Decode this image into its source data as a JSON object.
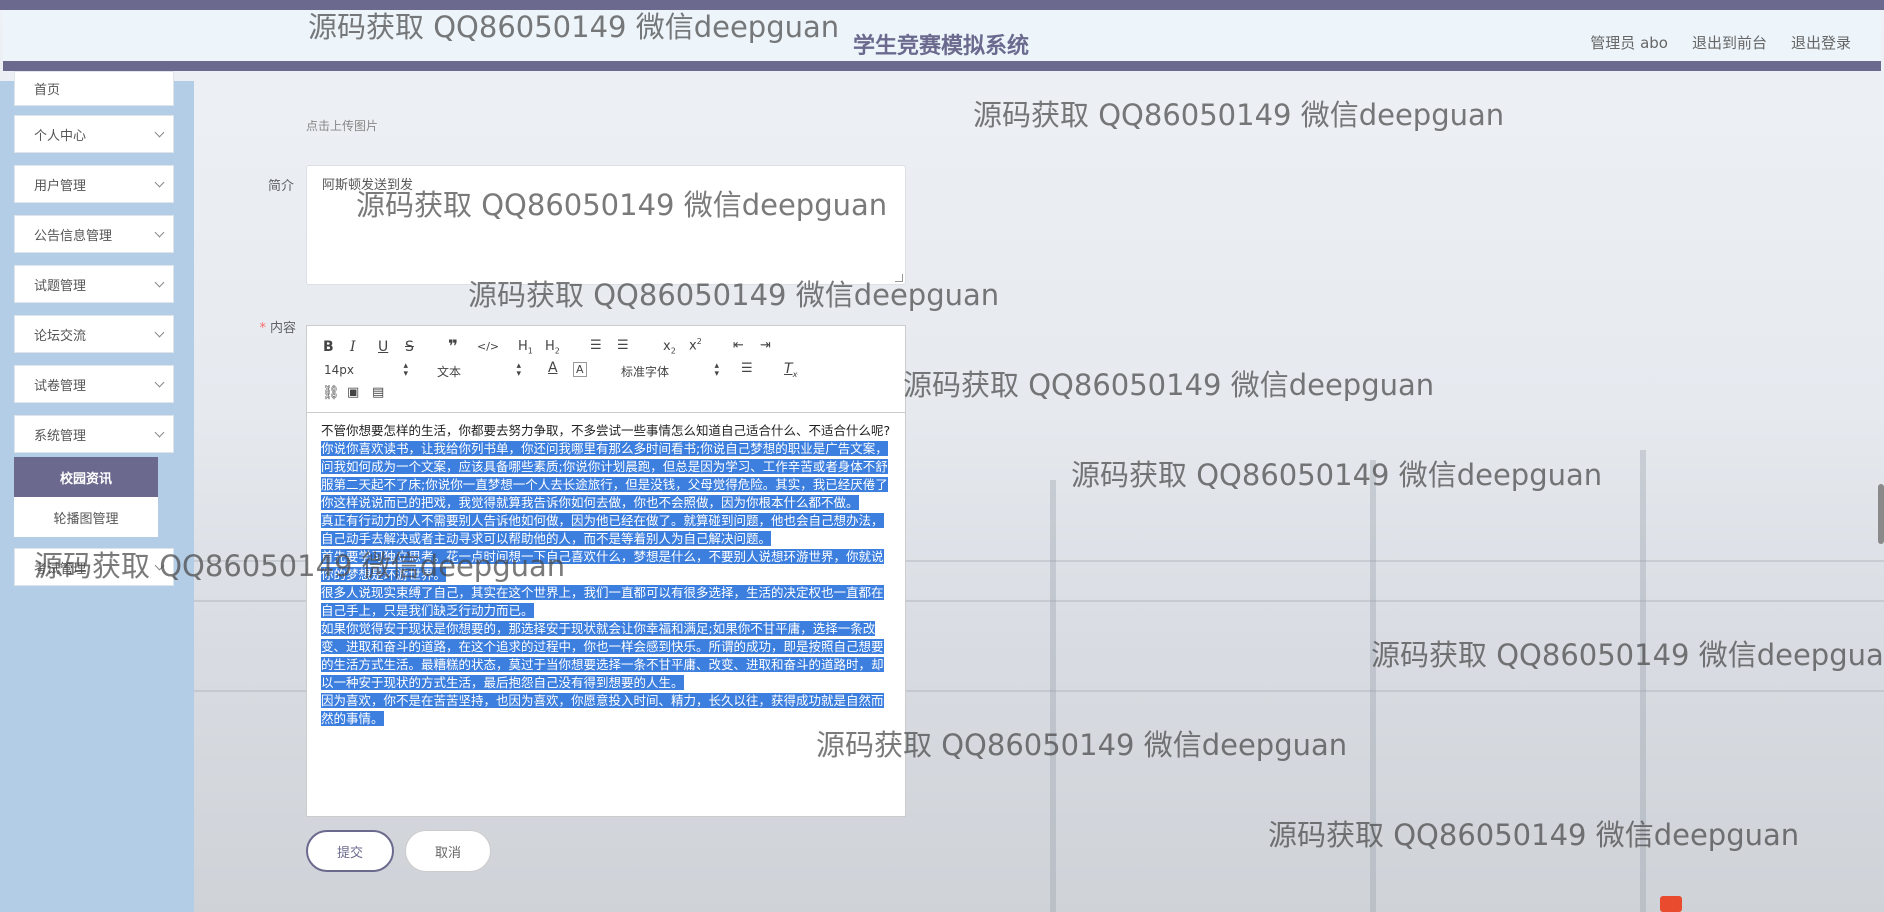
{
  "header": {
    "title": "学生竞赛模拟系统",
    "nav": [
      "管理员 abo",
      "退出到前台",
      "退出登录"
    ]
  },
  "sidebar": {
    "items": [
      {
        "label": "首页"
      },
      {
        "label": "个人中心"
      },
      {
        "label": "用户管理"
      },
      {
        "label": "公告信息管理"
      },
      {
        "label": "试题管理"
      },
      {
        "label": "论坛交流"
      },
      {
        "label": "试卷管理"
      },
      {
        "label": "系统管理"
      }
    ],
    "sub_items": [
      {
        "label": "校园资讯",
        "active": true
      },
      {
        "label": "轮播图管理",
        "active": false
      }
    ],
    "partial_item": "考试管理"
  },
  "form": {
    "upload_hint": "点击上传图片",
    "intro_label": "简介",
    "intro_value": "阿斯顿发送到发",
    "content_label": "内容",
    "required_mark": "*",
    "submit": "提交",
    "cancel": "取消"
  },
  "editor": {
    "font_size": "14px",
    "paragraph": "文本",
    "font_family": "标准字体",
    "content": [
      {
        "text": "不管你想要怎样的生活，你都要去努力争取，不多尝试一些事情怎么知道自己适合什么、不适合什么呢?",
        "selected": false
      },
      {
        "text": "你说你喜欢读书，让我给你列书单，你还问我哪里有那么多时间看书;你说自己梦想的职业是广告文案，问我如何成为一个文案，应该具备哪些素质;你说你计划晨跑，但总是因为学习、工作辛苦或者身体不舒服第二天起不了床;你说你一直梦想一个人去长途旅行，但是没钱，父母觉得危险。其实，我已经厌倦了你这样说说而已的把戏，我觉得就算我告诉你如何去做，你也不会照做，因为你根本什么都不做。",
        "selected": true
      },
      {
        "text": "真正有行动力的人不需要别人告诉他如何做，因为他已经在做了。就算碰到问题，他也会自己想办法，自己动手去解决或者主动寻求可以帮助他的人，而不是等着别人为自己解决问题。",
        "selected": true
      },
      {
        "text": "首先要学习独立思考。花一点时间想一下自己喜欢什么，梦想是什么，不要别人说想环游世界，你就说你的梦想是环游世界。",
        "selected": true
      },
      {
        "text": "很多人说现实束缚了自己，其实在这个世界上，我们一直都可以有很多选择，生活的决定权也一直都在自己手上，只是我们缺乏行动力而已。",
        "selected": true
      },
      {
        "text": "如果你觉得安于现状是你想要的，那选择安于现状就会让你幸福和满足;如果你不甘平庸，选择一条改变、进取和奋斗的道路，在这个追求的过程中，你也一样会感到快乐。所谓的成功，即是按照自己想要的生活方式生活。最糟糕的状态，莫过于当你想要选择一条不甘平庸、改变、进取和奋斗的道路时，却以一种安于现状的方式生活，最后抱怨自己没有得到想要的人生。",
        "selected": true
      },
      {
        "text": "因为喜欢，你不是在苦苦坚持，也因为喜欢，你愿意投入时间、精力，长久以往，获得成功就是自然而然的事情。",
        "selected": true
      }
    ]
  },
  "watermark": "源码获取 QQ86050149 微信deepguan",
  "watermark_partial": "源码获取 QQ86050149 微信deepgua",
  "colors": {
    "accent": "#6b6a8e",
    "sidebar_bg": "#b4cde6",
    "header_bg": "#edf5fb",
    "selection": "#3d7fdf"
  }
}
